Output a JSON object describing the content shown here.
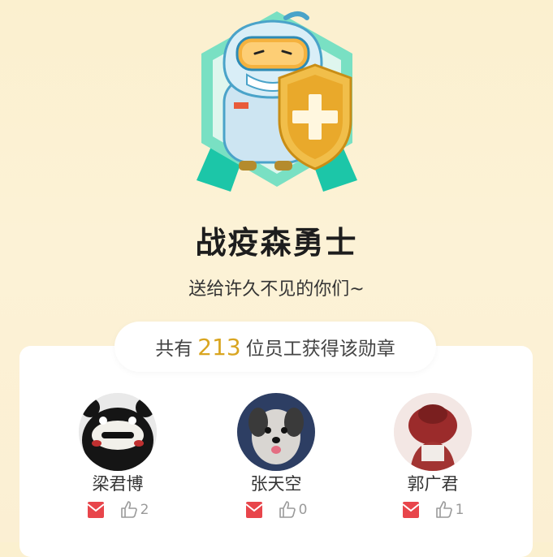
{
  "badge": {
    "name": "战疫森勇士",
    "description": "送给许久不见的你们~"
  },
  "summary": {
    "prefix": "共有",
    "count": "213",
    "suffix": "位员工获得该勋章"
  },
  "members": [
    {
      "name": "梁君博",
      "likes": "2",
      "avatar": "black-bear-mascot-avatar"
    },
    {
      "name": "张天空",
      "likes": "0",
      "avatar": "dog-avatar"
    },
    {
      "name": "郭广君",
      "likes": "1",
      "avatar": "red-hat-person-avatar"
    }
  ],
  "colors": {
    "accent_count": "#d9a520",
    "envelope": "#e8454b",
    "like_icon": "#9a9a9a"
  }
}
